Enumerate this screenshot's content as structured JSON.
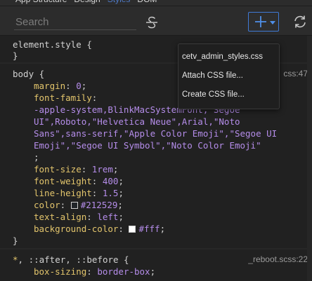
{
  "tabs": [
    {
      "label": "App Structure"
    },
    {
      "label": "Design"
    },
    {
      "label": "Styles"
    },
    {
      "label": "DOM"
    }
  ],
  "toolbar": {
    "search_placeholder": "Search",
    "search_value": ""
  },
  "element_style": {
    "selector": "element.style {",
    "close": "}"
  },
  "body_rule": {
    "selector": "body {",
    "source": "css:47",
    "margin_prop": "margin",
    "margin_val": "0",
    "font_family_prop": "font-family",
    "font_family_lines": [
      "-apple-system,BlinkMacSystemFont,\"Segoe",
      "UI\",Roboto,\"Helvetica Neue\",Arial,\"Noto",
      "Sans\",sans-serif,\"Apple Color Emoji\",\"Segoe UI",
      "Emoji\",\"Segoe UI Symbol\",\"Noto Color Emoji\""
    ],
    "font_family_end": ";",
    "font_size_prop": "font-size",
    "font_size_val": "1rem",
    "font_weight_prop": "font-weight",
    "font_weight_val": "400",
    "line_height_prop": "line-height",
    "line_height_val": "1.5",
    "color_prop": "color",
    "color_val": "#212529",
    "color_swatch": "#212529",
    "text_align_prop": "text-align",
    "text_align_val": "left",
    "bg_prop": "background-color",
    "bg_val": "#fff",
    "bg_swatch": "#ffffff",
    "close": "}"
  },
  "reboot_rule": {
    "star": "*",
    "selector": ", ::after, ::before {",
    "source": "_reboot.scss:22",
    "box_sizing_prop": "box-sizing",
    "box_sizing_val": "border-box"
  },
  "menu": {
    "items": [
      {
        "label": "cetv_admin_styles.css"
      },
      {
        "label": "Attach CSS file..."
      },
      {
        "label": "Create CSS file..."
      }
    ]
  },
  "colors": {
    "accent": "#3f7ad6",
    "property": "#e3c56c",
    "value": "#b58dea"
  }
}
